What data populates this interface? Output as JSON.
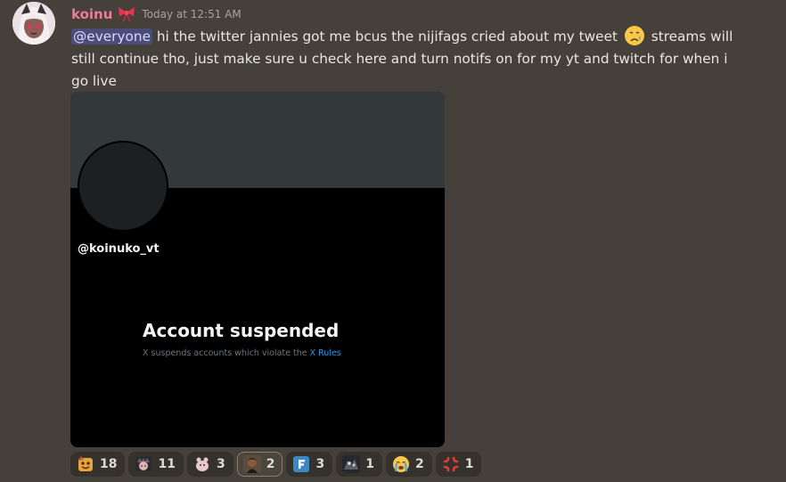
{
  "message": {
    "username": "koinu",
    "timestamp": "Today at 12:51 AM",
    "mention": "@everyone",
    "text": " hi the twitter jannies got me bcus the nijifags cried about my tweet ",
    "text_after_emoji": " streams will still continue tho, just make sure u check here and turn notifs on for my yt and twitch for when i go live",
    "inline_emoji": "crying-face-icon"
  },
  "attachment": {
    "handle": "@koinuko_vt",
    "title": "Account suspended",
    "subtitle": "X suspends accounts which violate the ",
    "rules_link": "X Rules"
  },
  "reactions": [
    {
      "icon": "custom-emoji-1-icon",
      "count": "18"
    },
    {
      "icon": "custom-emoji-2-icon",
      "count": "11"
    },
    {
      "icon": "custom-emoji-3-icon",
      "count": "3"
    },
    {
      "icon": "custom-emoji-4-icon",
      "count": "2",
      "selected": true
    },
    {
      "icon": "letter-f-icon",
      "count": "3"
    },
    {
      "icon": "custom-emoji-6-icon",
      "count": "1"
    },
    {
      "icon": "loudly-crying-face-icon",
      "count": "2"
    },
    {
      "icon": "anger-symbol-icon",
      "count": "1"
    }
  ],
  "colors": {
    "background": "#45403a",
    "username": "#f27a95",
    "mention_bg": "#5865f2",
    "link": "#1d9bf0"
  }
}
